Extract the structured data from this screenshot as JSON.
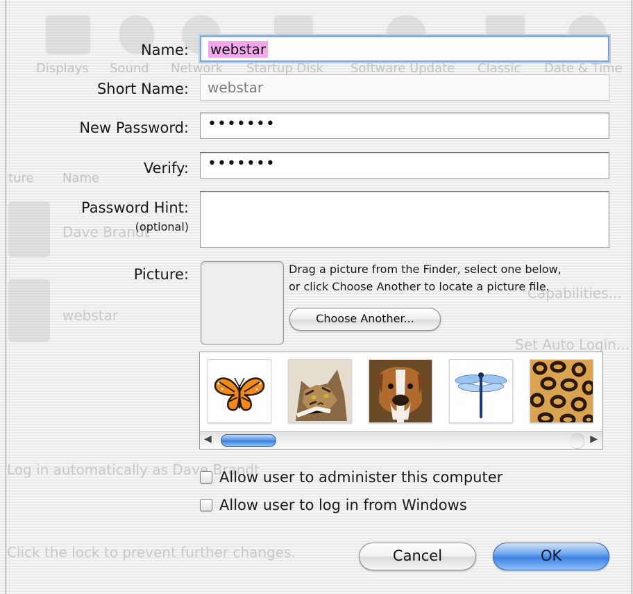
{
  "form": {
    "name_label": "Name:",
    "name_value": "webstar",
    "short_name_label": "Short Name:",
    "short_name_value": "webstar",
    "new_password_label": "New Password:",
    "new_password_value": "•••••••",
    "verify_label": "Verify:",
    "verify_value": "•••••••",
    "password_hint_label": "Password Hint:",
    "password_hint_optional": "(optional)",
    "password_hint_value": ""
  },
  "picture": {
    "label": "Picture:",
    "instructions_line1": "Drag a picture from the Finder, select one below,",
    "instructions_line2": "or click Choose Another to locate a picture file.",
    "choose_another_label": "Choose Another...",
    "thumbnails": [
      "butterfly-icon",
      "cat-icon",
      "dog-icon",
      "dragonfly-icon",
      "leopard-print-icon"
    ]
  },
  "options": {
    "administer_label": "Allow user to administer this computer",
    "administer_checked": false,
    "windows_login_label": "Allow user to log in from Windows",
    "windows_login_checked": false
  },
  "buttons": {
    "cancel_label": "Cancel",
    "ok_label": "OK"
  },
  "background_window": {
    "toolbar_labels": [
      "Displays",
      "Sound",
      "Network",
      "Startup Disk",
      "Software Update",
      "Classic",
      "Date & Time"
    ],
    "column_picture": "ture",
    "column_name": "Name",
    "user_1": "Dave Brandt",
    "user_2": "webstar",
    "capabilities": "Capabilities...",
    "auto_login": "Set Auto Login...",
    "auto_login_text": "Log in automatically as Dave Brandt",
    "lock_text": "Click the lock to prevent further changes."
  },
  "colors": {
    "selection_highlight": "#f3a8ec",
    "focus_ring": "#7fa6d6",
    "default_button": "#3c82e3"
  }
}
